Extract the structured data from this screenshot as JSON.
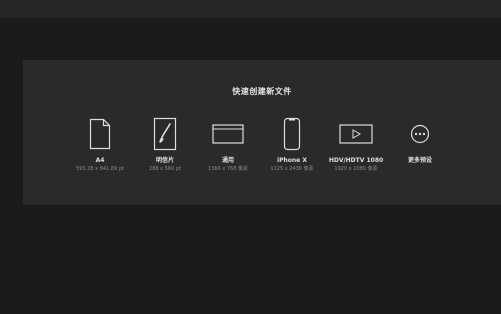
{
  "dialog": {
    "title": "快速创建新文件"
  },
  "presets": [
    {
      "name": "A4",
      "dims": "595.28 x 841.89 pt",
      "icon": "document-icon"
    },
    {
      "name": "明信片",
      "dims": "288 x 560 pt",
      "icon": "brush-card-icon"
    },
    {
      "name": "通用",
      "dims": "1366 x 768 像素",
      "icon": "browser-window-icon"
    },
    {
      "name": "iPhone X",
      "dims": "1125 x 2436 像素",
      "icon": "phone-icon"
    },
    {
      "name": "HDV/HDTV 1080",
      "dims": "1920 x 1080 像素",
      "icon": "video-play-icon"
    },
    {
      "name": "更多预设",
      "dims": "",
      "icon": "more-options-icon"
    }
  ]
}
